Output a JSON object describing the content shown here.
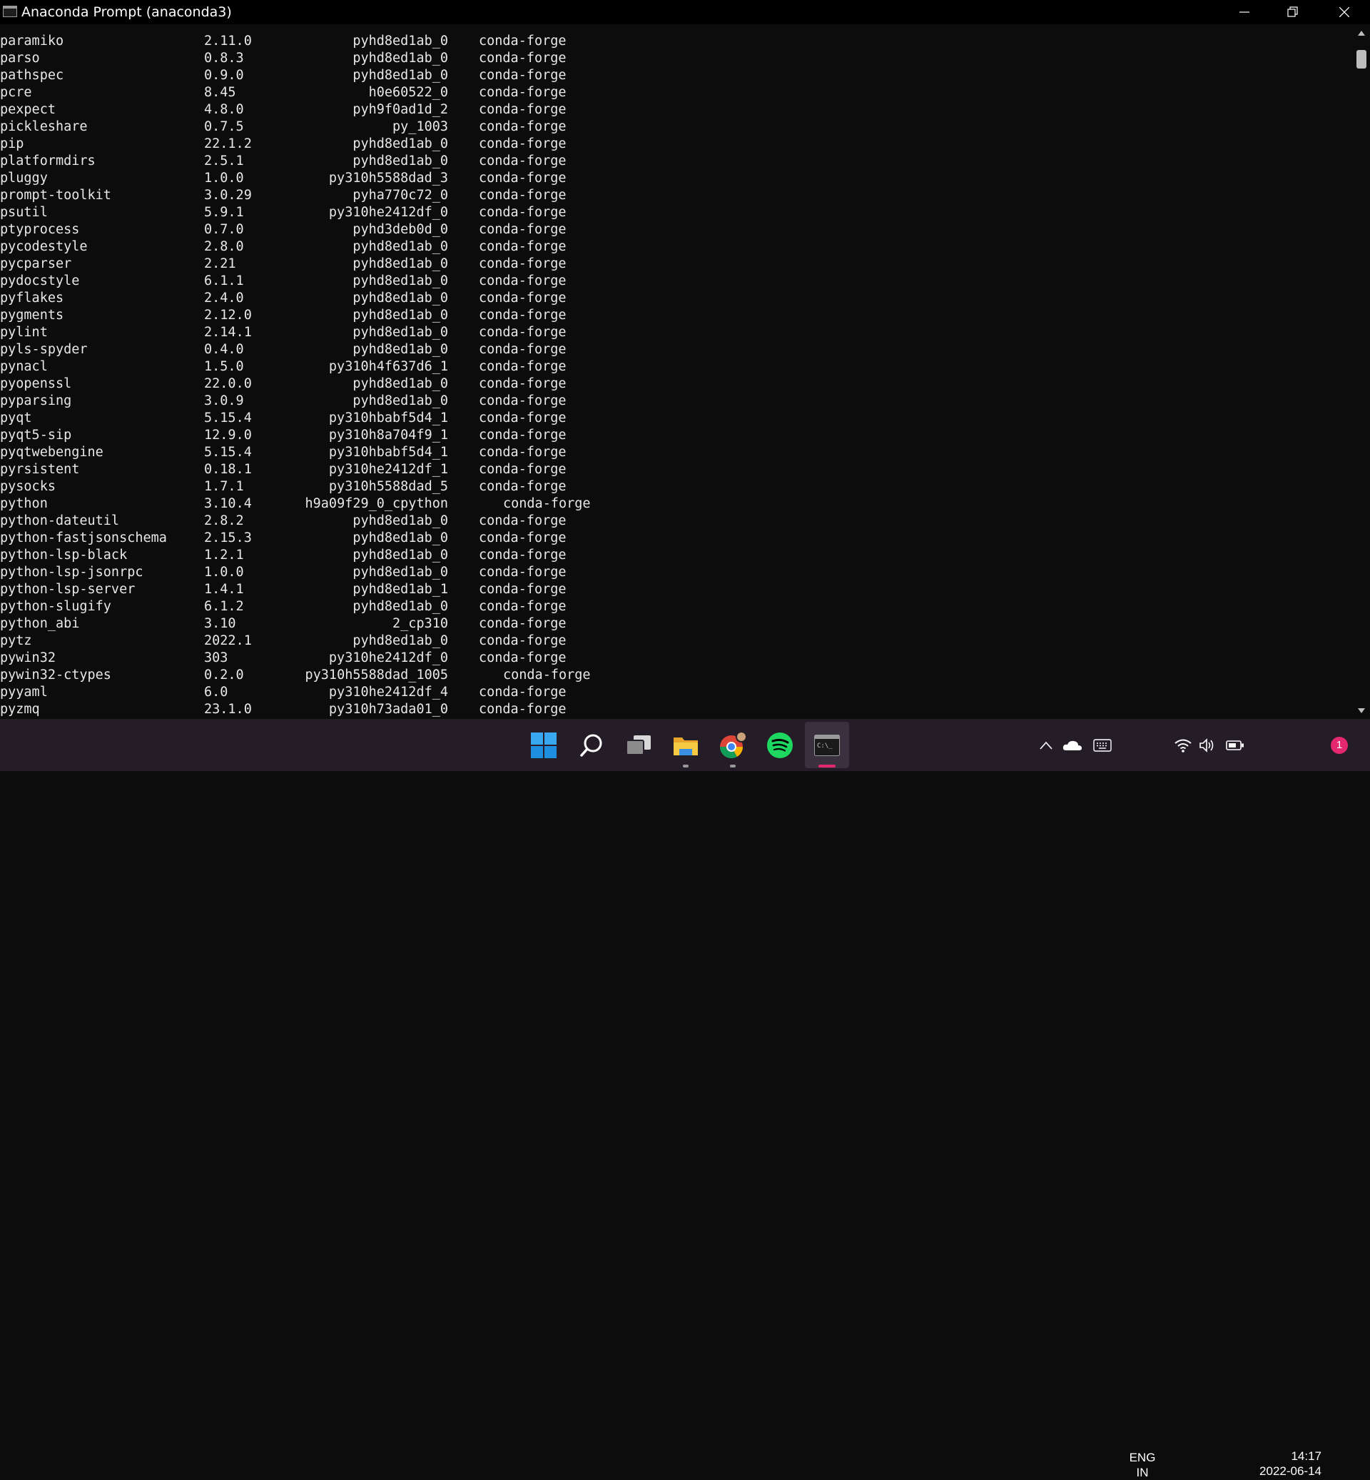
{
  "window": {
    "title": "Anaconda Prompt (anaconda3)"
  },
  "packages": [
    {
      "name": "paramiko",
      "version": "2.11.0",
      "build": "pyhd8ed1ab_0",
      "channel": "conda-forge"
    },
    {
      "name": "parso",
      "version": "0.8.3",
      "build": "pyhd8ed1ab_0",
      "channel": "conda-forge"
    },
    {
      "name": "pathspec",
      "version": "0.9.0",
      "build": "pyhd8ed1ab_0",
      "channel": "conda-forge"
    },
    {
      "name": "pcre",
      "version": "8.45",
      "build": "h0e60522_0",
      "channel": "conda-forge"
    },
    {
      "name": "pexpect",
      "version": "4.8.0",
      "build": "pyh9f0ad1d_2",
      "channel": "conda-forge"
    },
    {
      "name": "pickleshare",
      "version": "0.7.5",
      "build": "py_1003",
      "channel": "conda-forge"
    },
    {
      "name": "pip",
      "version": "22.1.2",
      "build": "pyhd8ed1ab_0",
      "channel": "conda-forge"
    },
    {
      "name": "platformdirs",
      "version": "2.5.1",
      "build": "pyhd8ed1ab_0",
      "channel": "conda-forge"
    },
    {
      "name": "pluggy",
      "version": "1.0.0",
      "build": "py310h5588dad_3",
      "channel": "conda-forge"
    },
    {
      "name": "prompt-toolkit",
      "version": "3.0.29",
      "build": "pyha770c72_0",
      "channel": "conda-forge"
    },
    {
      "name": "psutil",
      "version": "5.9.1",
      "build": "py310he2412df_0",
      "channel": "conda-forge"
    },
    {
      "name": "ptyprocess",
      "version": "0.7.0",
      "build": "pyhd3deb0d_0",
      "channel": "conda-forge"
    },
    {
      "name": "pycodestyle",
      "version": "2.8.0",
      "build": "pyhd8ed1ab_0",
      "channel": "conda-forge"
    },
    {
      "name": "pycparser",
      "version": "2.21",
      "build": "pyhd8ed1ab_0",
      "channel": "conda-forge"
    },
    {
      "name": "pydocstyle",
      "version": "6.1.1",
      "build": "pyhd8ed1ab_0",
      "channel": "conda-forge"
    },
    {
      "name": "pyflakes",
      "version": "2.4.0",
      "build": "pyhd8ed1ab_0",
      "channel": "conda-forge"
    },
    {
      "name": "pygments",
      "version": "2.12.0",
      "build": "pyhd8ed1ab_0",
      "channel": "conda-forge"
    },
    {
      "name": "pylint",
      "version": "2.14.1",
      "build": "pyhd8ed1ab_0",
      "channel": "conda-forge"
    },
    {
      "name": "pyls-spyder",
      "version": "0.4.0",
      "build": "pyhd8ed1ab_0",
      "channel": "conda-forge"
    },
    {
      "name": "pynacl",
      "version": "1.5.0",
      "build": "py310h4f637d6_1",
      "channel": "conda-forge"
    },
    {
      "name": "pyopenssl",
      "version": "22.0.0",
      "build": "pyhd8ed1ab_0",
      "channel": "conda-forge"
    },
    {
      "name": "pyparsing",
      "version": "3.0.9",
      "build": "pyhd8ed1ab_0",
      "channel": "conda-forge"
    },
    {
      "name": "pyqt",
      "version": "5.15.4",
      "build": "py310hbabf5d4_1",
      "channel": "conda-forge"
    },
    {
      "name": "pyqt5-sip",
      "version": "12.9.0",
      "build": "py310h8a704f9_1",
      "channel": "conda-forge"
    },
    {
      "name": "pyqtwebengine",
      "version": "5.15.4",
      "build": "py310hbabf5d4_1",
      "channel": "conda-forge"
    },
    {
      "name": "pyrsistent",
      "version": "0.18.1",
      "build": "py310he2412df_1",
      "channel": "conda-forge"
    },
    {
      "name": "pysocks",
      "version": "1.7.1",
      "build": "py310h5588dad_5",
      "channel": "conda-forge"
    },
    {
      "name": "python",
      "version": "3.10.4",
      "build": "h9a09f29_0_cpython",
      "channel": "conda-forge",
      "wide": true
    },
    {
      "name": "python-dateutil",
      "version": "2.8.2",
      "build": "pyhd8ed1ab_0",
      "channel": "conda-forge"
    },
    {
      "name": "python-fastjsonschema",
      "version": "2.15.3",
      "build": "pyhd8ed1ab_0",
      "channel": "conda-forge"
    },
    {
      "name": "python-lsp-black",
      "version": "1.2.1",
      "build": "pyhd8ed1ab_0",
      "channel": "conda-forge"
    },
    {
      "name": "python-lsp-jsonrpc",
      "version": "1.0.0",
      "build": "pyhd8ed1ab_0",
      "channel": "conda-forge"
    },
    {
      "name": "python-lsp-server",
      "version": "1.4.1",
      "build": "pyhd8ed1ab_1",
      "channel": "conda-forge"
    },
    {
      "name": "python-slugify",
      "version": "6.1.2",
      "build": "pyhd8ed1ab_0",
      "channel": "conda-forge"
    },
    {
      "name": "python_abi",
      "version": "3.10",
      "build": "2_cp310",
      "channel": "conda-forge"
    },
    {
      "name": "pytz",
      "version": "2022.1",
      "build": "pyhd8ed1ab_0",
      "channel": "conda-forge"
    },
    {
      "name": "pywin32",
      "version": "303",
      "build": "py310he2412df_0",
      "channel": "conda-forge"
    },
    {
      "name": "pywin32-ctypes",
      "version": "0.2.0",
      "build": "py310h5588dad_1005",
      "channel": "conda-forge",
      "wide": true
    },
    {
      "name": "pyyaml",
      "version": "6.0",
      "build": "py310he2412df_4",
      "channel": "conda-forge"
    },
    {
      "name": "pyzmq",
      "version": "23.1.0",
      "build": "py310h73ada01_0",
      "channel": "conda-forge"
    }
  ],
  "taskbar": {
    "apps": [
      {
        "name": "start",
        "icon": "windows-logo-icon"
      },
      {
        "name": "search",
        "icon": "search-icon"
      },
      {
        "name": "task-view",
        "icon": "task-view-icon"
      },
      {
        "name": "file-explorer",
        "icon": "folder-icon",
        "running": true
      },
      {
        "name": "chrome",
        "icon": "chrome-icon",
        "running": true
      },
      {
        "name": "spotify",
        "icon": "spotify-icon"
      },
      {
        "name": "terminal",
        "icon": "terminal-icon",
        "running": true,
        "active": true
      }
    ],
    "tray": {
      "language": "ENG",
      "region": "IN",
      "time": "14:17",
      "date": "2022-06-14",
      "notifications": "1"
    }
  },
  "colors": {
    "console_bg": "#0c0c0c",
    "console_text": "#e8e8e8",
    "taskbar_bg": "#241d27",
    "active_indicator": "#e4286e"
  }
}
